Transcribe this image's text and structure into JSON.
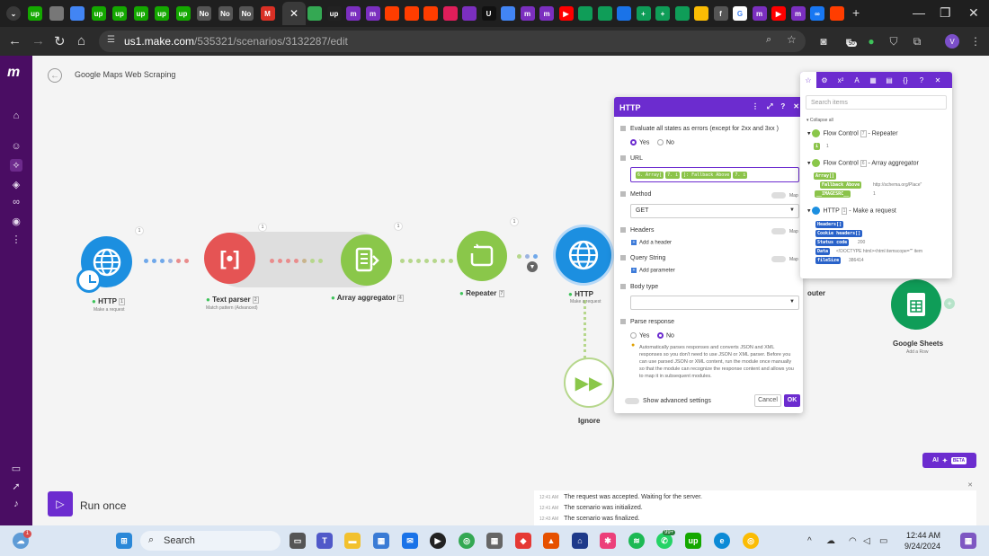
{
  "browser": {
    "url_host": "us1.make.com",
    "url_path": "/535321/scenarios/3132287/edit",
    "tabs": [
      {
        "icon": "upwork-icon",
        "text": "up",
        "color": "#14a800"
      },
      {
        "icon": "web-icon",
        "text": "",
        "color": "#777777"
      },
      {
        "icon": "docs-icon",
        "text": "",
        "color": "#4285f4"
      },
      {
        "icon": "upwork-icon",
        "text": "up",
        "color": "#14a800"
      },
      {
        "icon": "upwork-icon",
        "text": "up",
        "color": "#14a800"
      },
      {
        "icon": "upwork-icon",
        "text": "up",
        "color": "#14a800"
      },
      {
        "icon": "upwork-icon",
        "text": "up",
        "color": "#14a800"
      },
      {
        "icon": "upwork-icon",
        "text": "up",
        "color": "#14a800"
      },
      {
        "icon": "notion-icon",
        "text": "No",
        "color": "#555555"
      },
      {
        "icon": "notion-icon",
        "text": "No",
        "color": "#555555"
      },
      {
        "icon": "notion-icon",
        "text": "No",
        "color": "#555555"
      },
      {
        "icon": "gmail-icon",
        "text": "M",
        "color": "#d93025"
      }
    ],
    "tabs_right": [
      {
        "icon": "maps-icon",
        "text": "",
        "color": "#34a853"
      },
      {
        "icon": "upwork-icon",
        "text": "up",
        "color": "#222222"
      },
      {
        "icon": "make-icon",
        "text": "m",
        "color": "#7b2fbf"
      },
      {
        "icon": "make-icon",
        "text": "m",
        "color": "#7b2fbf"
      },
      {
        "icon": "square-icon",
        "text": "",
        "color": "#ff3d00"
      },
      {
        "icon": "square-icon",
        "text": "",
        "color": "#ff3d00"
      },
      {
        "icon": "square-icon",
        "text": "",
        "color": "#ff3d00"
      },
      {
        "icon": "slack-icon",
        "text": "",
        "color": "#e01e5a"
      },
      {
        "icon": "vs-icon",
        "text": "",
        "color": "#7b2fbf"
      },
      {
        "icon": "u-icon",
        "text": "U",
        "color": "#111111"
      },
      {
        "icon": "link-icon",
        "text": "",
        "color": "#4285f4"
      },
      {
        "icon": "make-icon",
        "text": "m",
        "color": "#7b2fbf"
      },
      {
        "icon": "make-icon",
        "text": "m",
        "color": "#7b2fbf"
      },
      {
        "icon": "youtube-icon",
        "text": "▶",
        "color": "#ff0000"
      },
      {
        "icon": "drive-icon",
        "text": "",
        "color": "#0f9d58"
      },
      {
        "icon": "drive-icon",
        "text": "",
        "color": "#0f9d58"
      },
      {
        "icon": "circle-icon",
        "text": "",
        "color": "#1a73e8"
      },
      {
        "icon": "plus-icon",
        "text": "+",
        "color": "#0f9d58"
      },
      {
        "icon": "plus-icon",
        "text": "+",
        "color": "#0f9d58"
      },
      {
        "icon": "drive-icon",
        "text": "",
        "color": "#0f9d58"
      },
      {
        "icon": "note-icon",
        "text": "",
        "color": "#fbbc04"
      },
      {
        "icon": "f-icon",
        "text": "f",
        "color": "#555555"
      },
      {
        "icon": "google-icon",
        "text": "G",
        "color": "#ffffff"
      },
      {
        "icon": "make-icon",
        "text": "m",
        "color": "#7b2fbf"
      },
      {
        "icon": "youtube-icon",
        "text": "▶",
        "color": "#ff0000"
      },
      {
        "icon": "make-icon",
        "text": "m",
        "color": "#7b2fbf"
      },
      {
        "icon": "meta-icon",
        "text": "∞",
        "color": "#1877f2"
      },
      {
        "icon": "square-icon",
        "text": "",
        "color": "#ff3d00"
      }
    ],
    "extension_badge": "50",
    "profile_initial": "V"
  },
  "scenario": {
    "title": "Google Maps Web Scraping"
  },
  "modules": [
    {
      "label": "HTTP",
      "num": "1",
      "sub": "Make a request",
      "color": "#1c8fe0",
      "icon": "globe-icon"
    },
    {
      "label": "Text parser",
      "num": "2",
      "sub": "Match pattern (Advanced)",
      "color": "#e55454",
      "icon": "text-parser-icon"
    },
    {
      "label": "Array aggregator",
      "num": "4",
      "sub": "",
      "color": "#8ac74a",
      "icon": "aggregator-icon"
    },
    {
      "label": "Repeater",
      "num": "7",
      "sub": "",
      "color": "#8ac74a",
      "icon": "repeater-icon"
    },
    {
      "label": "HTTP",
      "num": "",
      "sub": "Make a request",
      "color": "#1c8fe0",
      "icon": "globe-icon"
    },
    {
      "label": "Ignore",
      "num": "",
      "sub": "",
      "color": "#8ac74a",
      "icon": "ignore-icon"
    },
    {
      "label": "Router",
      "num": "",
      "sub": "",
      "color": "#8ac74a",
      "icon": "router-icon"
    },
    {
      "label": "Google Sheets",
      "num": "",
      "sub": "Add a Row",
      "color": "#0f9d58",
      "icon": "sheets-icon"
    }
  ],
  "http_dialog": {
    "title": "HTTP",
    "evaluate_label": "Evaluate all states as errors (except for 2xx and 3xx )",
    "yes": "Yes",
    "no": "No",
    "url_label": "URL",
    "url_pills": [
      "6. Array[",
      "7. i",
      "]: Fallback Above",
      "7. i"
    ],
    "method_label": "Method",
    "method_value": "GET",
    "map_label": "Map",
    "headers_label": "Headers",
    "add_header": "Add a header",
    "query_label": "Query String",
    "add_parameter": "Add parameter",
    "body_label": "Body type",
    "parse_label": "Parse response",
    "parse_help": "Automatically parses responses and converts JSON and XML responses so you don't need to use JSON or XML parser. Before you can use parsed JSON or XML content, run the module once manually so that the module can recognize the response content and allows you to map it in subsequent modules.",
    "advanced_label": "Show advanced settings",
    "cancel": "Cancel",
    "ok": "OK"
  },
  "mapping_panel": {
    "search_placeholder": "Search items",
    "collapse_all": "Collapse all",
    "groups": [
      {
        "name": "Flow Control",
        "num": "7",
        "action": "Repeater",
        "color": "#8ac74a"
      },
      {
        "name": "Flow Control",
        "num": "6",
        "action": "Array aggregator",
        "color": "#8ac74a"
      },
      {
        "name": "HTTP",
        "num": "1",
        "action": "Make a request",
        "color": "#1c8fe0"
      }
    ],
    "repeater_i": "i",
    "repeater_i_val": "1",
    "array_pill": "Array[]",
    "fallback_pill": "Fallback Above",
    "fallback_val": "http://schema.org/Place\"",
    "imagesrc_pill": "__IMAGESRC__",
    "imagesrc_val": "1",
    "http_items": [
      {
        "key": "Headers[]",
        "val": ""
      },
      {
        "key": "Cookie headers[]",
        "val": ""
      },
      {
        "key": "Status code",
        "val": "200"
      },
      {
        "key": "Data",
        "val": "<!DOCTYPE html><html itemscope=\"\" item"
      },
      {
        "key": "fileSize",
        "val": "386414"
      }
    ]
  },
  "run_once": "Run once",
  "log": [
    {
      "time": "12:41 AM",
      "text": "The request was accepted. Waiting for the server."
    },
    {
      "time": "12:41 AM",
      "text": "The scenario was initialized."
    },
    {
      "time": "12:43 AM",
      "text": "The scenario was finalized."
    }
  ],
  "ai_button": {
    "label": "AI",
    "beta": "BETA"
  },
  "taskbar": {
    "search": "Search",
    "time": "12:44 AM",
    "date": "9/24/2024",
    "whatsapp_badge": "99+",
    "notif_badge": "1"
  }
}
